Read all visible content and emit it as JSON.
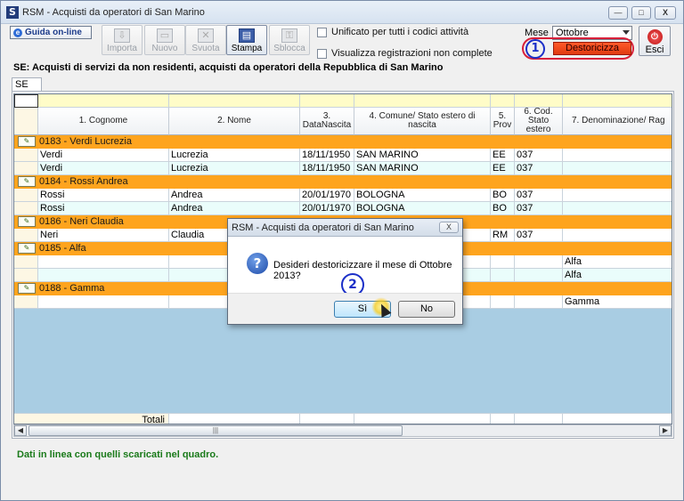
{
  "window": {
    "title": "RSM - Acquisti da operatori di San Marino",
    "controls": {
      "minimize": "—",
      "maximize": "□",
      "close": "X"
    }
  },
  "toolbar": {
    "guida_label": "Guida on-line",
    "buttons": [
      {
        "label": "Importa",
        "icon": "import-icon",
        "enabled": false
      },
      {
        "label": "Nuovo",
        "icon": "new-document-icon",
        "enabled": false
      },
      {
        "label": "Svuota",
        "icon": "clear-icon",
        "enabled": false
      },
      {
        "label": "Stampa",
        "icon": "printer-icon",
        "enabled": true
      },
      {
        "label": "Sblocca",
        "icon": "unlock-icon",
        "enabled": false
      }
    ],
    "check_unificato": "Unificato per tutti i codici attività",
    "check_visualizza": "Visualizza registrazioni non complete",
    "mese_label": "Mese",
    "mese_value": "Ottobre",
    "destoricizza_label": "Destoricizza",
    "esci_label": "Esci",
    "annotation_1": "1"
  },
  "section_title": "SE: Acquisti di servizi da non residenti, acquisti da operatori della Repubblica di San Marino",
  "tab_label": "SE",
  "columns": [
    "1. Cognome",
    "2. Nome",
    "3. DataNascita",
    "4. Comune/ Stato estero di nascita",
    "5. Prov",
    "6. Cod. Stato estero",
    "7. Denominazione/ Rag"
  ],
  "groups": [
    {
      "label": "0183 - Verdi Lucrezia",
      "rows": [
        [
          "Verdi",
          "Lucrezia",
          "18/11/1950",
          "SAN MARINO",
          "EE",
          "037",
          ""
        ],
        [
          "Verdi",
          "Lucrezia",
          "18/11/1950",
          "SAN MARINO",
          "EE",
          "037",
          ""
        ]
      ]
    },
    {
      "label": "0184 - Rossi Andrea",
      "rows": [
        [
          "Rossi",
          "Andrea",
          "20/01/1970",
          "BOLOGNA",
          "BO",
          "037",
          ""
        ],
        [
          "Rossi",
          "Andrea",
          "20/01/1970",
          "BOLOGNA",
          "BO",
          "037",
          ""
        ]
      ]
    },
    {
      "label": "0186 - Neri Claudia",
      "rows": [
        [
          "Neri",
          "Claudia",
          "",
          "",
          "RM",
          "037",
          ""
        ]
      ]
    },
    {
      "label": "0185 - Alfa",
      "rows": [
        [
          "",
          "",
          "",
          "",
          "",
          "",
          "Alfa"
        ],
        [
          "",
          "",
          "",
          "",
          "",
          "",
          "Alfa"
        ]
      ]
    },
    {
      "label": "0188 - Gamma",
      "rows": [
        [
          "",
          "",
          "",
          "",
          "",
          "",
          "Gamma"
        ]
      ]
    }
  ],
  "totals_label": "Totali",
  "status_text": "Dati in linea con quelli scaricati nel quadro.",
  "dialog": {
    "title": "RSM - Acquisti da operatori di San Marino",
    "message": "Desideri destoricizzare il mese di Ottobre 2013?",
    "yes_label": "Sì",
    "no_label": "No",
    "annotation_2": "2"
  },
  "colors": {
    "group_row": "#fea41e",
    "destoricizza": "#ff4a1e",
    "annotation": "#1b2fc8",
    "status_text": "#1a7a1a"
  }
}
